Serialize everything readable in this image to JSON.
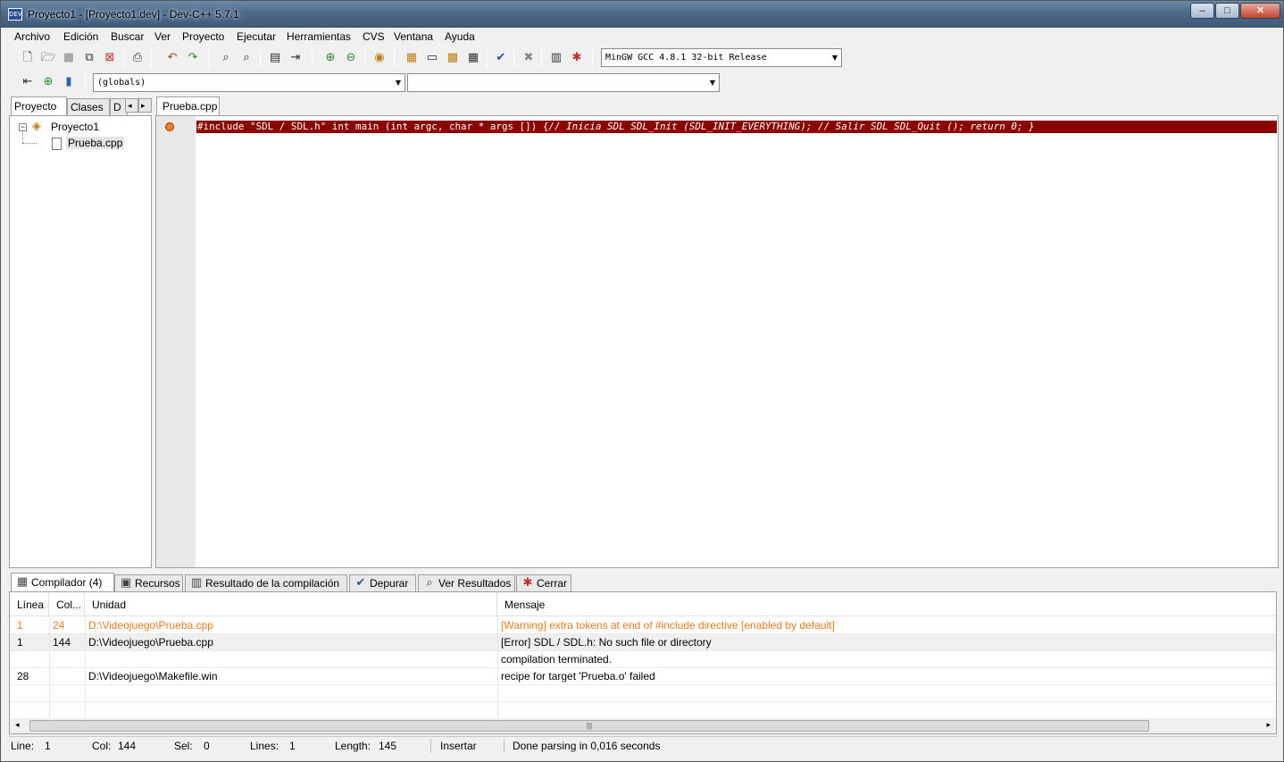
{
  "window": {
    "title": "Proyecto1 - [Proyecto1.dev] - Dev-C++ 5.7.1",
    "app_icon_text": "DEV",
    "controls": {
      "minimize": "‒",
      "maximize": "□",
      "close": "✕"
    }
  },
  "menu": [
    "Archivo",
    "Edición",
    "Buscar",
    "Ver",
    "Proyecto",
    "Ejecutar",
    "Herramientas",
    "CVS",
    "Ventana",
    "Ayuda"
  ],
  "toolbar": {
    "compiler_select": "MinGW GCC 4.8.1 32-bit Release",
    "scope_select": "(globals)",
    "member_select": ""
  },
  "left_panel": {
    "tabs": [
      "Proyecto",
      "Clases",
      "D"
    ],
    "tree": {
      "project": "Proyecto1",
      "file": "Prueba.cpp"
    }
  },
  "editor": {
    "tab": "Prueba.cpp",
    "code_main": "#include \"SDL / SDL.h\" int main (int argc, char * args []) {",
    "code_comment": "// Inicia SDL SDL_Init (SDL_INIT_EVERYTHING); // Salir SDL SDL_Quit (); return 0; }",
    "error_line_color": "#8b0000"
  },
  "bottom_tabs": [
    "Compilador (4)",
    "Recursos",
    "Resultado de la compilación",
    "Depurar",
    "Ver Resultados",
    "Cerrar"
  ],
  "messages": {
    "columns": [
      "Línea",
      "Col...",
      "Unidad",
      "Mensaje"
    ],
    "rows": [
      {
        "line": "1",
        "col": "24",
        "unit": "D:\\Videojuego\\Prueba.cpp",
        "message": "[Warning] extra tokens at end of #include directive [enabled by default]",
        "kind": "warning"
      },
      {
        "line": "1",
        "col": "144",
        "unit": "D:\\Videojuego\\Prueba.cpp",
        "message": "[Error] SDL / SDL.h: No such file or directory",
        "kind": "error"
      },
      {
        "line": "",
        "col": "",
        "unit": "",
        "message": "compilation terminated.",
        "kind": "info"
      },
      {
        "line": "28",
        "col": "",
        "unit": "D:\\Videojuego\\Makefile.win",
        "message": "recipe for target 'Prueba.o' failed",
        "kind": "info"
      }
    ],
    "warning_color": "#ec7b20"
  },
  "status": {
    "line_label": "Line:",
    "line_value": "1",
    "col_label": "Col:",
    "col_value": "144",
    "sel_label": "Sel:",
    "sel_value": "0",
    "lines_label": "Lines:",
    "lines_value": "1",
    "length_label": "Length:",
    "length_value": "145",
    "mode": "Insertar",
    "message": "Done parsing in 0,016 seconds"
  }
}
